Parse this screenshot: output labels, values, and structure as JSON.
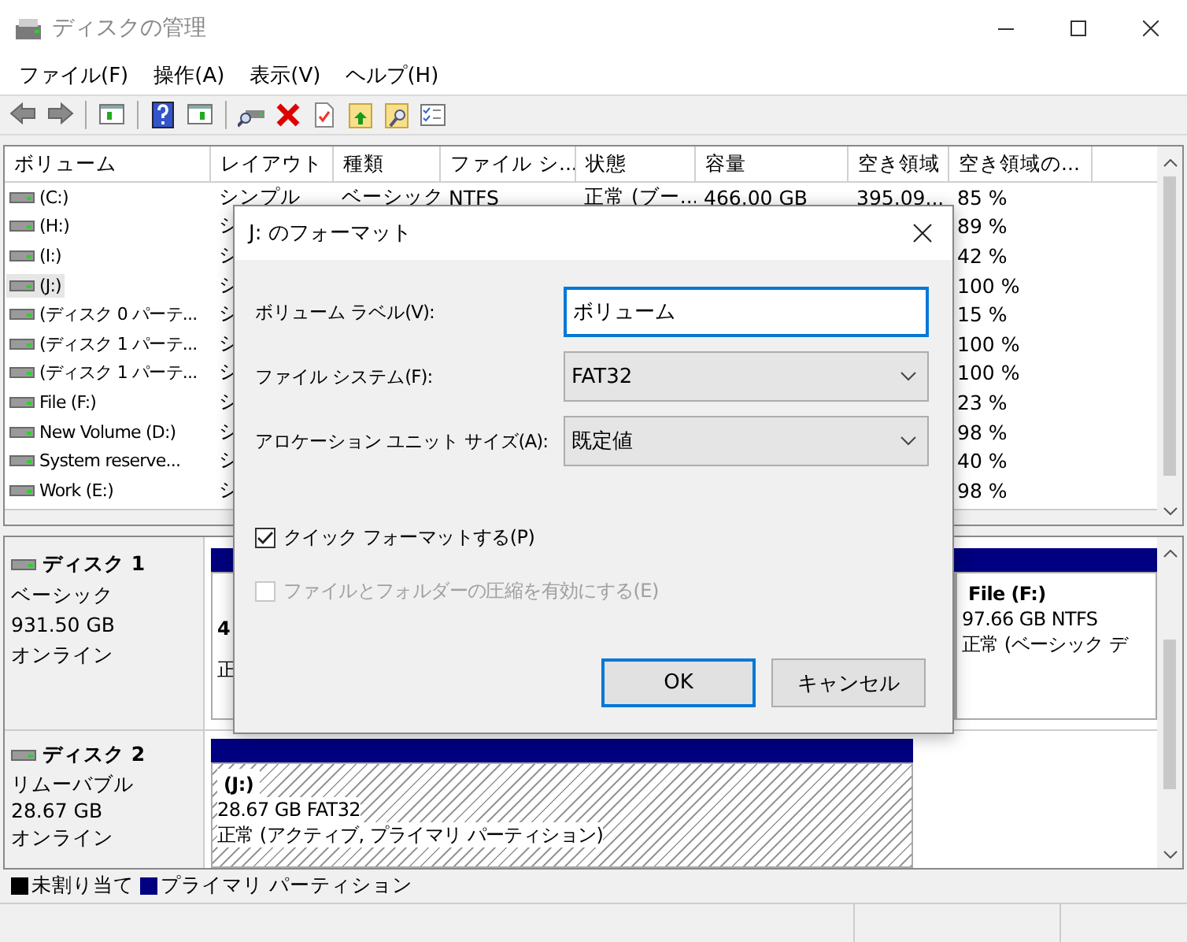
{
  "window": {
    "title": "ディスクの管理"
  },
  "menu": [
    "ファイル(F)",
    "操作(A)",
    "表示(V)",
    "ヘルプ(H)"
  ],
  "volume_table": {
    "columns": [
      "ボリューム",
      "レイアウト",
      "種類",
      "ファイル シ...",
      "状態",
      "容量",
      "空き領域",
      "空き領域の..."
    ],
    "rows": [
      {
        "volume": "(C:)",
        "layout": "シンプル",
        "type": "ベーシック",
        "file_system": "NTFS",
        "status": "正常 (ブー...",
        "capacity": "466.00 GB",
        "free_space": "395.09...",
        "free_percent": "85 %",
        "selected": false
      },
      {
        "volume": "(H:)",
        "layout": "シ",
        "free_percent": "89 %",
        "selected": false
      },
      {
        "volume": "(I:)",
        "layout": "シ",
        "free_percent": "42 %",
        "selected": false
      },
      {
        "volume": "(J:)",
        "layout": "シ",
        "free_percent": "100 %",
        "selected": true
      },
      {
        "volume": "(ディスク 0 パーテ...",
        "layout": "シ",
        "free_percent": "15 %",
        "selected": false
      },
      {
        "volume": "(ディスク 1 パーテ...",
        "layout": "シ",
        "free_percent": "100 %",
        "selected": false
      },
      {
        "volume": "(ディスク 1 パーテ...",
        "layout": "シ",
        "free_percent": "100 %",
        "selected": false
      },
      {
        "volume": "File (F:)",
        "layout": "シ",
        "free_percent": "23 %",
        "selected": false
      },
      {
        "volume": "New Volume (D:)",
        "layout": "シ",
        "free_percent": "98 %",
        "selected": false
      },
      {
        "volume": "System reserve...",
        "layout": "シ",
        "free_percent": "40 %",
        "selected": false
      },
      {
        "volume": "Work (E:)",
        "layout": "シ",
        "free_percent": "98 %",
        "selected": false
      }
    ]
  },
  "disks": [
    {
      "name": "ディスク 1",
      "type": "ベーシック",
      "size": "931.50 GB",
      "status": "オンライン",
      "partitions": [
        {
          "kind": "wide",
          "selected": false,
          "lines": [
            "4",
            "正"
          ]
        },
        {
          "kind": "narrow",
          "selected": false,
          "lines": [
            "File  (F:)",
            "97.66 GB NTFS",
            "正常 (ベーシック デ"
          ]
        }
      ]
    },
    {
      "name": "ディスク 2",
      "type": "リムーバブル",
      "size": "28.67 GB",
      "status": "オンライン",
      "partitions": [
        {
          "kind": "fixed",
          "selected": true,
          "lines": [
            "(J:)",
            "28.67 GB FAT32",
            "正常 (アクティブ, プライマリ パーティション)"
          ]
        }
      ]
    }
  ],
  "legend": [
    {
      "label": "未割り当て",
      "color": "#000000"
    },
    {
      "label": "プライマリ パーティション",
      "color": "#000080"
    }
  ],
  "dialog": {
    "title": "J: のフォーマット",
    "fields": [
      {
        "kind": "text",
        "label": "ボリューム ラベル(V):",
        "value": "ボリューム",
        "focused": true
      },
      {
        "kind": "select",
        "label": "ファイル システム(F):",
        "value": "FAT32"
      },
      {
        "kind": "select",
        "label": "アロケーション ユニット サイズ(A):",
        "value": "既定値"
      }
    ],
    "checkboxes": [
      {
        "label": "クイック フォーマットする(P)",
        "checked": true,
        "disabled": false
      },
      {
        "label": "ファイルとフォルダーの圧縮を有効にする(E)",
        "checked": false,
        "disabled": true
      }
    ],
    "buttons": [
      {
        "label": "OK",
        "default": true
      },
      {
        "label": "キャンセル",
        "default": false
      }
    ]
  }
}
